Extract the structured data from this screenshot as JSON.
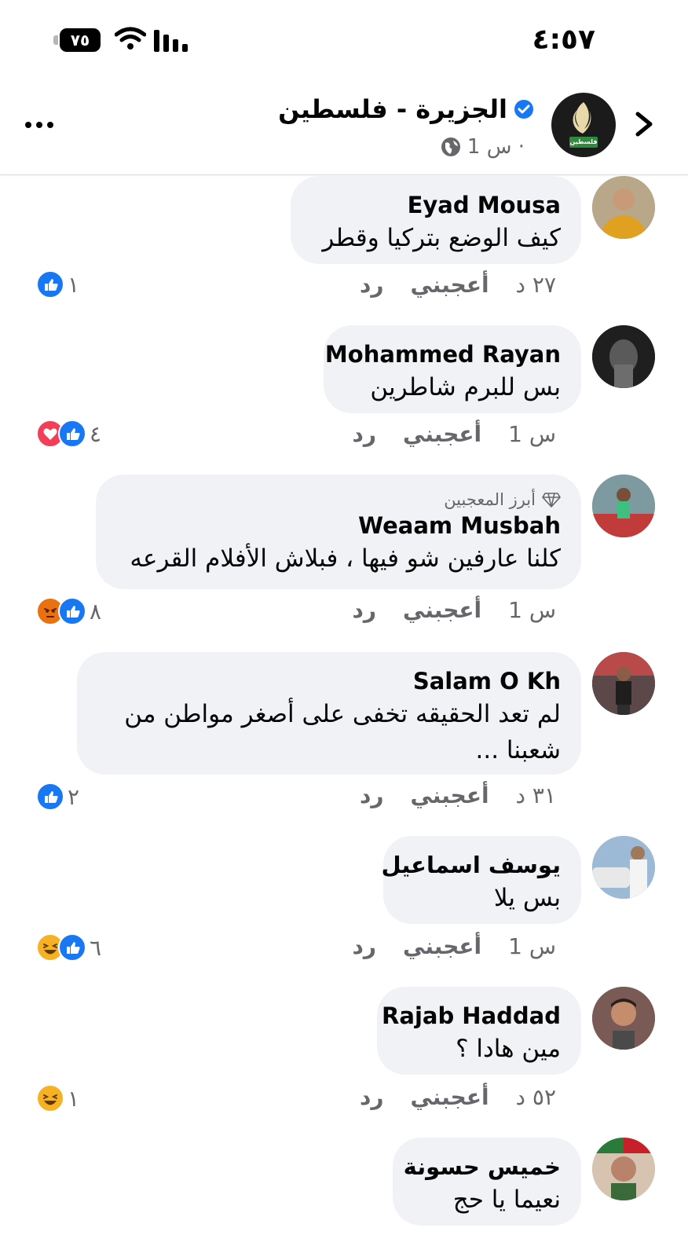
{
  "status": {
    "time": "٤:٥٧",
    "battery": "٧٥"
  },
  "header": {
    "page_name": "الجزيرة  - فلسطين",
    "post_time": "1 س ·",
    "avatar_tag": "فلسطين"
  },
  "comments": [
    {
      "author": "Eyad Mousa",
      "text": "كيف الوضع بتركيا وقطر",
      "time": "٢٧ د",
      "like": "أعجبني",
      "reply": "رد",
      "reactions": [
        "like"
      ],
      "count": "١"
    },
    {
      "author": "Mohammed Rayan",
      "text": "بس للبرم شاطرين",
      "time": "1 س",
      "like": "أعجبني",
      "reply": "رد",
      "reactions": [
        "like",
        "love"
      ],
      "count": "٤"
    },
    {
      "author": "Weaam Musbah",
      "badge": "أبرز المعجبين",
      "text": "كلنا عارفين شو فيها ، فبلاش الأفلام القرعه",
      "time": "1 س",
      "like": "أعجبني",
      "reply": "رد",
      "reactions": [
        "like",
        "angry"
      ],
      "count": "٨"
    },
    {
      "author": "Salam O Kh",
      "text": "لم تعد الحقيقه تخفى على أصغر مواطن من شعبنا ...",
      "time": "٣١ د",
      "like": "أعجبني",
      "reply": "رد",
      "reactions": [
        "like"
      ],
      "count": "٢"
    },
    {
      "author": "يوسف اسماعيل",
      "text": "بس يلا",
      "time": "1 س",
      "like": "أعجبني",
      "reply": "رد",
      "reactions": [
        "like",
        "haha"
      ],
      "count": "٦"
    },
    {
      "author": "Rajab Haddad",
      "text": "مين هادا ؟",
      "time": "٥٢ د",
      "like": "أعجبني",
      "reply": "رد",
      "reactions": [
        "haha"
      ],
      "count": "١"
    },
    {
      "author": "خميس حسونة",
      "text": "نعيما يا حج"
    }
  ],
  "colors": {
    "like": "#1877f2",
    "love": "#f33e58",
    "angry": "#e9710f",
    "haha": "#f7b125",
    "bubble": "#f0f2f5",
    "meta": "#65676b"
  }
}
